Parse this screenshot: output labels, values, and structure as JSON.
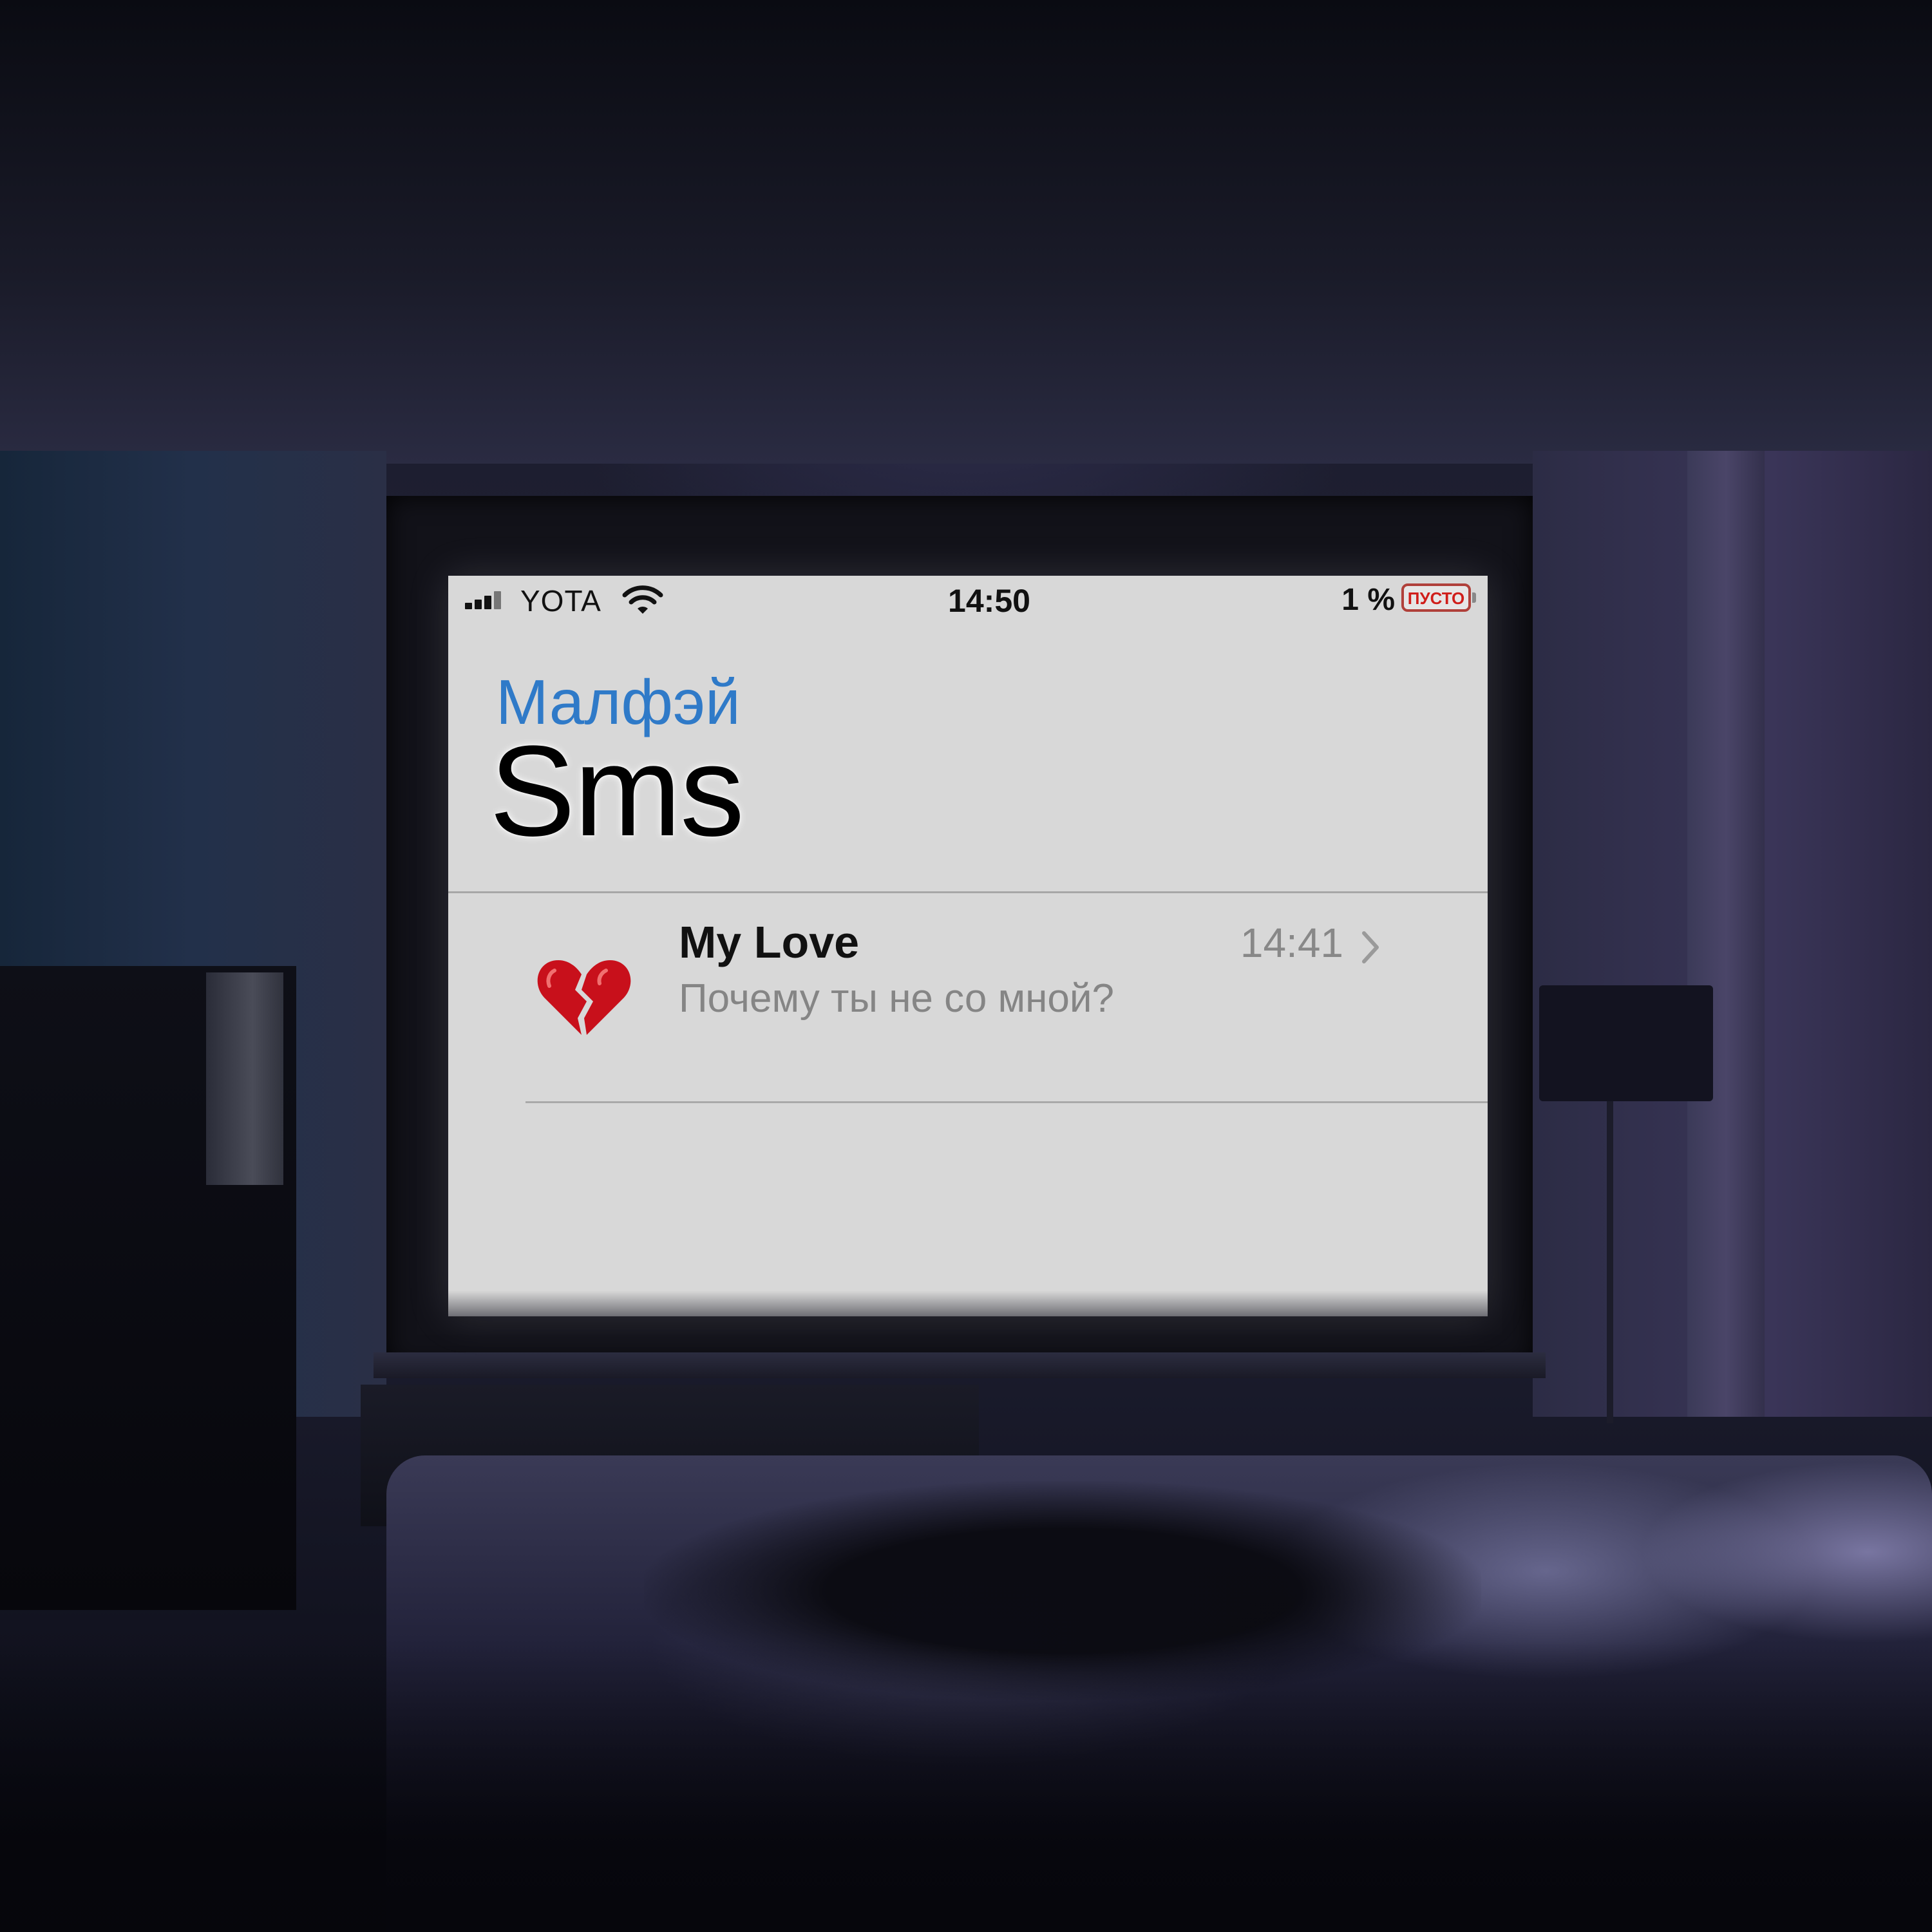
{
  "status_bar": {
    "carrier": "YOTA",
    "time": "14:50",
    "battery_percent": "1 %",
    "battery_label": "ПУСТО",
    "signal_icon": "signal-bars-icon",
    "wifi_icon": "wifi-icon"
  },
  "nav": {
    "back_label": "Малфэй",
    "title": "Sms"
  },
  "conversations": [
    {
      "avatar_icon": "broken-heart-icon",
      "avatar_glyph": "💔",
      "name": "My Love",
      "time": "14:41",
      "preview": "Почему ты не со мной?",
      "chevron_icon": "chevron-right-icon"
    }
  ],
  "colors": {
    "link_blue": "#2f7ac8",
    "screen_bg": "#d8d8d8",
    "battery_red": "#d01e1a"
  }
}
